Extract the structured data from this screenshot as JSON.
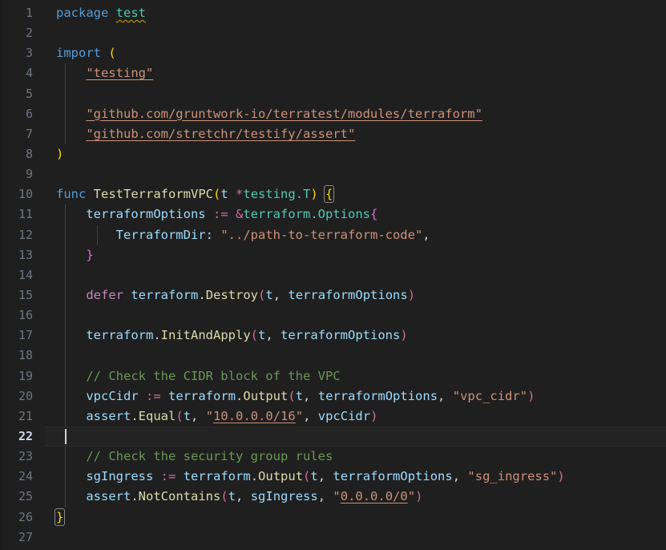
{
  "editor": {
    "language": "go",
    "theme": "dark-plus",
    "background": "#1f1f1f",
    "active_line": 22,
    "total_lines": 27,
    "cursor": {
      "line": 22,
      "column": 2
    }
  },
  "colors": {
    "keyword": "#569cd6",
    "control_keyword": "#c586c0",
    "type": "#4ec9b0",
    "function": "#dcdcaa",
    "variable": "#9cdcfe",
    "string": "#ce9178",
    "comment": "#6a9955",
    "operator": "#d16d9e",
    "bracket_yellow": "#ffd700",
    "bracket_magenta": "#da70d6",
    "line_number": "#6e7681",
    "active_line_number": "#cfd6e4",
    "active_line_bg": "#232323",
    "indent_guide": "#404040",
    "warning_squiggle": "#cca700",
    "link_underline": "#ce9178"
  },
  "gutter": {
    "line_numbers": [
      1,
      2,
      3,
      4,
      5,
      6,
      7,
      8,
      9,
      10,
      11,
      12,
      13,
      14,
      15,
      16,
      17,
      18,
      19,
      20,
      21,
      22,
      23,
      24,
      25,
      26,
      27
    ]
  },
  "lines": [
    {
      "n": 1,
      "text": "package test"
    },
    {
      "n": 2,
      "text": ""
    },
    {
      "n": 3,
      "text": "import ("
    },
    {
      "n": 4,
      "text": "    \"testing\""
    },
    {
      "n": 5,
      "text": ""
    },
    {
      "n": 6,
      "text": "    \"github.com/gruntwork-io/terratest/modules/terraform\""
    },
    {
      "n": 7,
      "text": "    \"github.com/stretchr/testify/assert\""
    },
    {
      "n": 8,
      "text": ")"
    },
    {
      "n": 9,
      "text": ""
    },
    {
      "n": 10,
      "text": "func TestTerraformVPC(t *testing.T) {"
    },
    {
      "n": 11,
      "text": "    terraformOptions := &terraform.Options{"
    },
    {
      "n": 12,
      "text": "        TerraformDir: \"../path-to-terraform-code\","
    },
    {
      "n": 13,
      "text": "    }"
    },
    {
      "n": 14,
      "text": ""
    },
    {
      "n": 15,
      "text": "    defer terraform.Destroy(t, terraformOptions)"
    },
    {
      "n": 16,
      "text": ""
    },
    {
      "n": 17,
      "text": "    terraform.InitAndApply(t, terraformOptions)"
    },
    {
      "n": 18,
      "text": ""
    },
    {
      "n": 19,
      "text": "    // Check the CIDR block of the VPC"
    },
    {
      "n": 20,
      "text": "    vpcCidr := terraform.Output(t, terraformOptions, \"vpc_cidr\")"
    },
    {
      "n": 21,
      "text": "    assert.Equal(t, \"10.0.0.0/16\", vpcCidr)"
    },
    {
      "n": 22,
      "text": "    "
    },
    {
      "n": 23,
      "text": "    // Check the security group rules"
    },
    {
      "n": 24,
      "text": "    sgIngress := terraform.Output(t, terraformOptions, \"sg_ingress\")"
    },
    {
      "n": 25,
      "text": "    assert.NotContains(t, sgIngress, \"0.0.0.0/0\")"
    },
    {
      "n": 26,
      "text": "}"
    },
    {
      "n": 27,
      "text": ""
    }
  ],
  "tokens": {
    "package_kw": "package",
    "package_name": "test",
    "import_kw": "import",
    "import_testing": "\"testing\"",
    "import_terratest": "\"github.com/gruntwork-io/terratest/modules/terraform\"",
    "import_testify": "\"github.com/stretchr/testify/assert\"",
    "func_kw": "func",
    "func_name": "TestTerraformVPC",
    "param_t": "t",
    "param_type": "testing.T",
    "var_terraform_options": "terraformOptions",
    "assign_op": ":=",
    "struct_type": "terraform.Options",
    "field_terraform_dir": "TerraformDir:",
    "value_terraform_dir": "\"../path-to-terraform-code\"",
    "defer_kw": "defer",
    "call_destroy": "terraform.Destroy",
    "call_init_apply": "terraform.InitAndApply",
    "comment_cidr": "// Check the CIDR block of the VPC",
    "var_vpc_cidr": "vpcCidr",
    "call_output": "terraform.Output",
    "str_vpc_cidr": "\"vpc_cidr\"",
    "call_assert_equal": "assert.Equal",
    "str_cidr_value": "\"10.0.0.0/16\"",
    "comment_sg": "// Check the security group rules",
    "var_sg_ingress": "sgIngress",
    "str_sg_ingress": "\"sg_ingress\"",
    "call_assert_not_contains": "assert.NotContains",
    "str_any_cidr": "\"0.0.0.0/0\""
  },
  "decorations": {
    "warning_on": "test",
    "links": [
      "\"testing\"",
      "\"github.com/gruntwork-io/terratest/modules/terraform\"",
      "\"github.com/stretchr/testify/assert\"",
      "10.0.0.0/16",
      "0.0.0.0/0"
    ],
    "bracket_match": [
      "{ on line 10",
      "} on line 26"
    ]
  }
}
